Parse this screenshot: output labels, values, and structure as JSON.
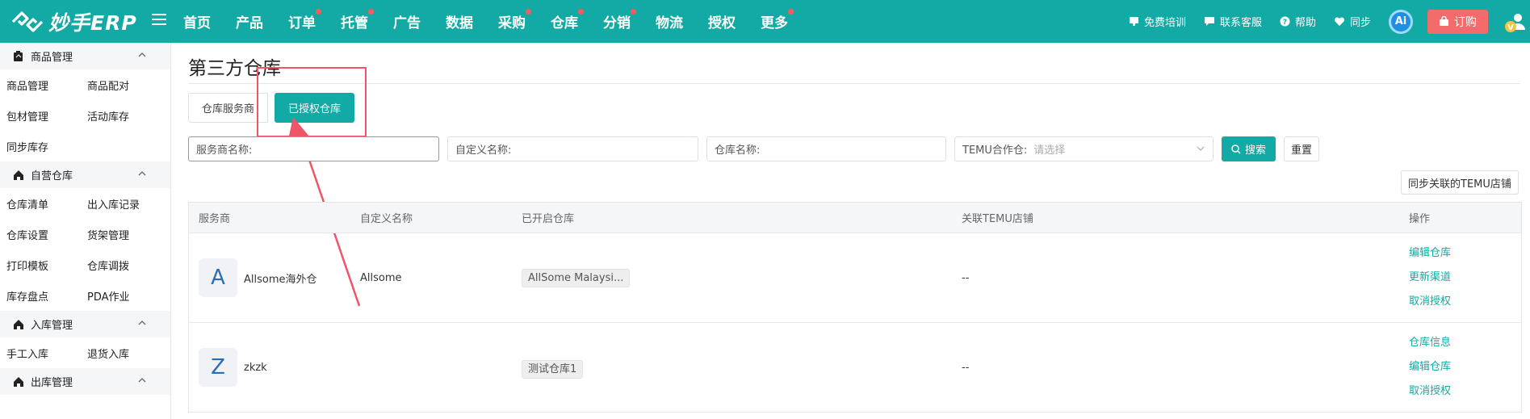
{
  "brand": {
    "name": "妙手ERP"
  },
  "nav": {
    "items": [
      {
        "label": "首页",
        "dot": false
      },
      {
        "label": "产品",
        "dot": false
      },
      {
        "label": "订单",
        "dot": true
      },
      {
        "label": "托管",
        "dot": true
      },
      {
        "label": "广告",
        "dot": false
      },
      {
        "label": "数据",
        "dot": false
      },
      {
        "label": "采购",
        "dot": true
      },
      {
        "label": "仓库",
        "dot": true
      },
      {
        "label": "分销",
        "dot": true
      },
      {
        "label": "物流",
        "dot": false
      },
      {
        "label": "授权",
        "dot": false
      },
      {
        "label": "更多",
        "dot": true
      }
    ],
    "right": {
      "training": "免费培训",
      "support": "联系客服",
      "help": "帮助",
      "sync": "同步",
      "ai": "Ai",
      "order": "订购"
    }
  },
  "sidebar": {
    "groups": [
      {
        "title": "商品管理",
        "icon": "clipboard-icon",
        "links": [
          "商品管理",
          "商品配对",
          "包材管理",
          "活动库存",
          "同步库存"
        ]
      },
      {
        "title": "自营仓库",
        "icon": "home-icon",
        "links": [
          "仓库清单",
          "出入库记录",
          "仓库设置",
          "货架管理",
          "打印模板",
          "仓库调拨",
          "库存盘点",
          "PDA作业"
        ]
      },
      {
        "title": "入库管理",
        "icon": "home-icon",
        "links": [
          "手工入库",
          "退货入库"
        ]
      },
      {
        "title": "出库管理",
        "icon": "home-icon",
        "links": []
      }
    ]
  },
  "page": {
    "title": "第三方仓库",
    "tabs": [
      "仓库服务商",
      "已授权仓库"
    ],
    "filters": {
      "provider": "服务商名称:",
      "custom": "自定义名称:",
      "warehouse": "仓库名称:",
      "temu_label": "TEMU合作仓:",
      "temu_placeholder": "请选择",
      "search": "搜索",
      "reset": "重置"
    },
    "sync_button": "同步关联的TEMU店铺",
    "table": {
      "headers": [
        "服务商",
        "自定义名称",
        "已开启仓库",
        "关联TEMU店铺",
        "操作"
      ],
      "rows": [
        {
          "avatar": "A",
          "provider": "Allsome海外仓",
          "custom": "Allsome",
          "warehouse": "AllSome Malaysi...",
          "temu": "--",
          "ops": [
            "编辑仓库",
            "更新渠道",
            "取消授权"
          ]
        },
        {
          "avatar": "Z",
          "provider": "zkzk",
          "custom": "",
          "warehouse": "测试仓库1",
          "temu": "--",
          "ops": [
            "仓库信息",
            "编辑仓库",
            "取消授权"
          ]
        }
      ]
    }
  },
  "colors": {
    "primary": "#13aaa5",
    "annotation": "#ee5566",
    "order": "#f46b6b"
  }
}
